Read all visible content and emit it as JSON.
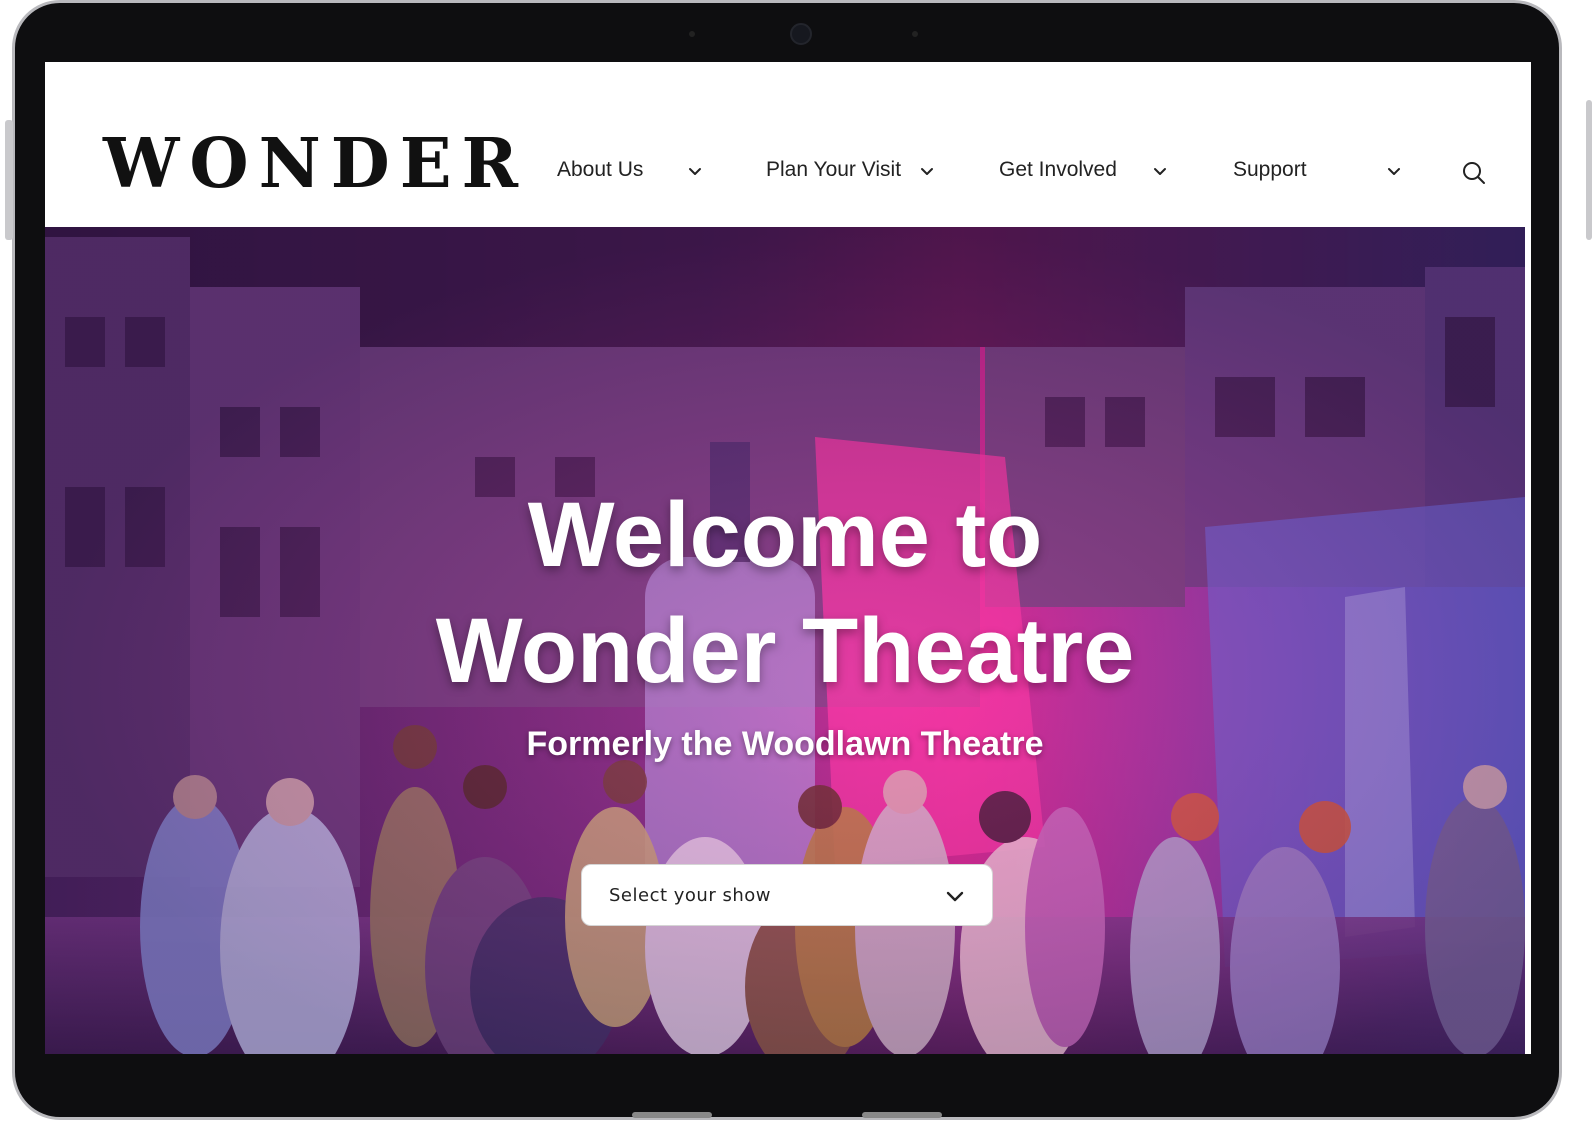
{
  "logo": {
    "text": "WONDER"
  },
  "nav": {
    "items": [
      {
        "label": "About Us"
      },
      {
        "label": "Plan Your Visit"
      },
      {
        "label": "Get Involved"
      },
      {
        "label": "Support"
      }
    ],
    "search_icon": "search-icon",
    "dropdown_icon": "chevron-down-icon"
  },
  "hero": {
    "title_line1": "Welcome to",
    "title_line2": "Wonder Theatre",
    "subtitle": "Formerly the Woodlawn Theatre",
    "show_select": {
      "placeholder": "Select your show"
    }
  },
  "colors": {
    "text_dark": "#222222",
    "hero_pink": "#c02a9b",
    "hero_purple": "#5c2a78",
    "white": "#ffffff"
  }
}
